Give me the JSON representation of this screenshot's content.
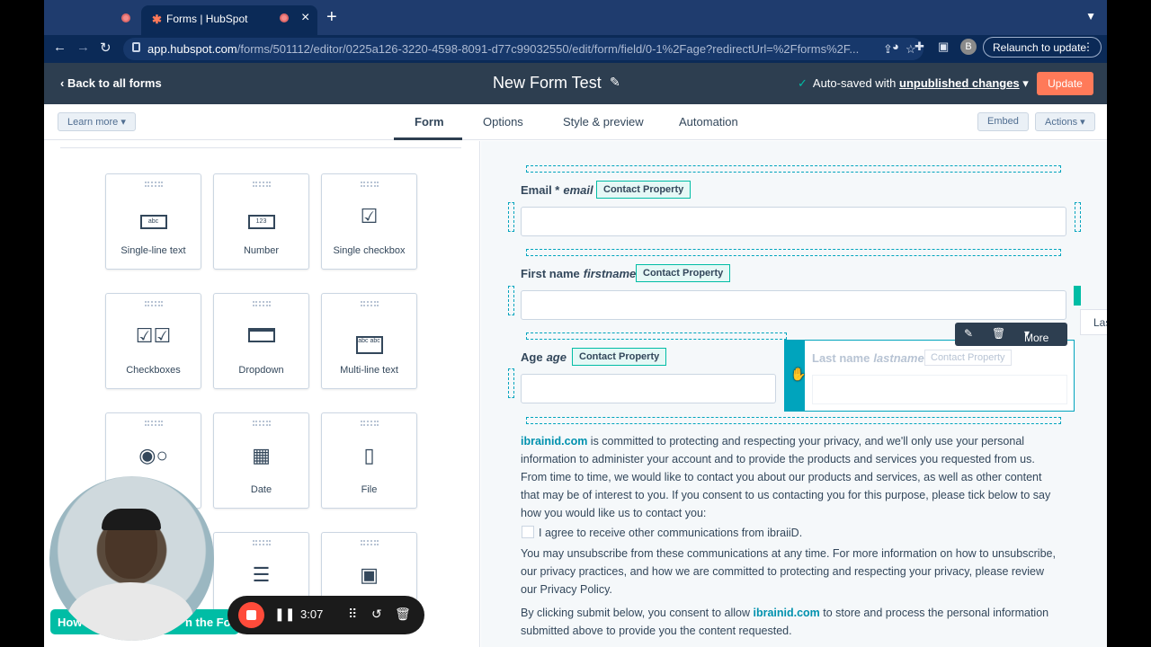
{
  "browser": {
    "tab_title": "Forms | HubSpot",
    "url_host": "app.hubspot.com",
    "url_path": "/forms/501112/editor/0225a126-3220-4598-8091-d77c99032550/edit/form/field/0-1%2Fage?redirectUrl=%2Fforms%2F...",
    "avatar_letter": "B",
    "relaunch_label": "Relaunch to update"
  },
  "header": {
    "back_label": "Back to all forms",
    "form_title": "New Form Test",
    "autosave_prefix": "Auto-saved with",
    "autosave_link": "unpublished changes",
    "update_label": "Update"
  },
  "subnav": {
    "learn_more": "Learn more",
    "tabs": [
      "Form",
      "Options",
      "Style & preview",
      "Automation"
    ],
    "embed": "Embed",
    "actions": "Actions"
  },
  "field_types": [
    {
      "label": "Single-line text",
      "icon": "abc"
    },
    {
      "label": "Number",
      "icon": "123"
    },
    {
      "label": "Single checkbox",
      "icon": "checkbox-icon"
    },
    {
      "label": "Checkboxes",
      "icon": "checkboxes-icon"
    },
    {
      "label": "Dropdown",
      "icon": "dropdown-icon"
    },
    {
      "label": "Multi-line text",
      "icon": "abc abc"
    },
    {
      "label": "",
      "icon": "radio-icon"
    },
    {
      "label": "Date",
      "icon": "calendar-icon"
    },
    {
      "label": "File",
      "icon": "file-icon"
    },
    {
      "label": "",
      "icon": "rich-text-icon"
    },
    {
      "label": "",
      "icon": "image-icon"
    }
  ],
  "form_fields": {
    "email": {
      "label": "Email *",
      "internal": "email",
      "badge": "Contact Property"
    },
    "firstname": {
      "label": "First name",
      "internal": "firstname",
      "badge": "Contact Property"
    },
    "age": {
      "label": "Age",
      "internal": "age",
      "badge": "Contact Property"
    },
    "lastname": {
      "label": "Last name",
      "internal": "lastname",
      "badge": "Contact Property"
    }
  },
  "toolbar": {
    "more": "More"
  },
  "side_stub": "Las",
  "consent": {
    "para1_link": "ibrainid.com",
    "para1": " is committed to protecting and respecting your privacy, and we'll only use your personal information to administer your account and to provide the products and services you requested from us. From time to time, we would like to contact you about our products and services, as well as other content that may be of interest to you. If you consent to us contacting you for this purpose, please tick below to say how you would like us to contact you:",
    "checkbox_label": "I agree to receive other communications from ibraiiD.",
    "para2": "You may unsubscribe from these communications at any time. For more information on how to unsubscribe, our privacy practices, and how we are committed to protecting and respecting your privacy, please review our Privacy Policy.",
    "para3_prefix": "By clicking submit below, you consent to allow ",
    "para3_link": "ibrainid.com",
    "para3_suffix": " to store and process the personal information submitted above to provide you the content requested."
  },
  "overlay": {
    "how_left": "How",
    "how_right": "n the For",
    "rec_time": "3:07"
  }
}
